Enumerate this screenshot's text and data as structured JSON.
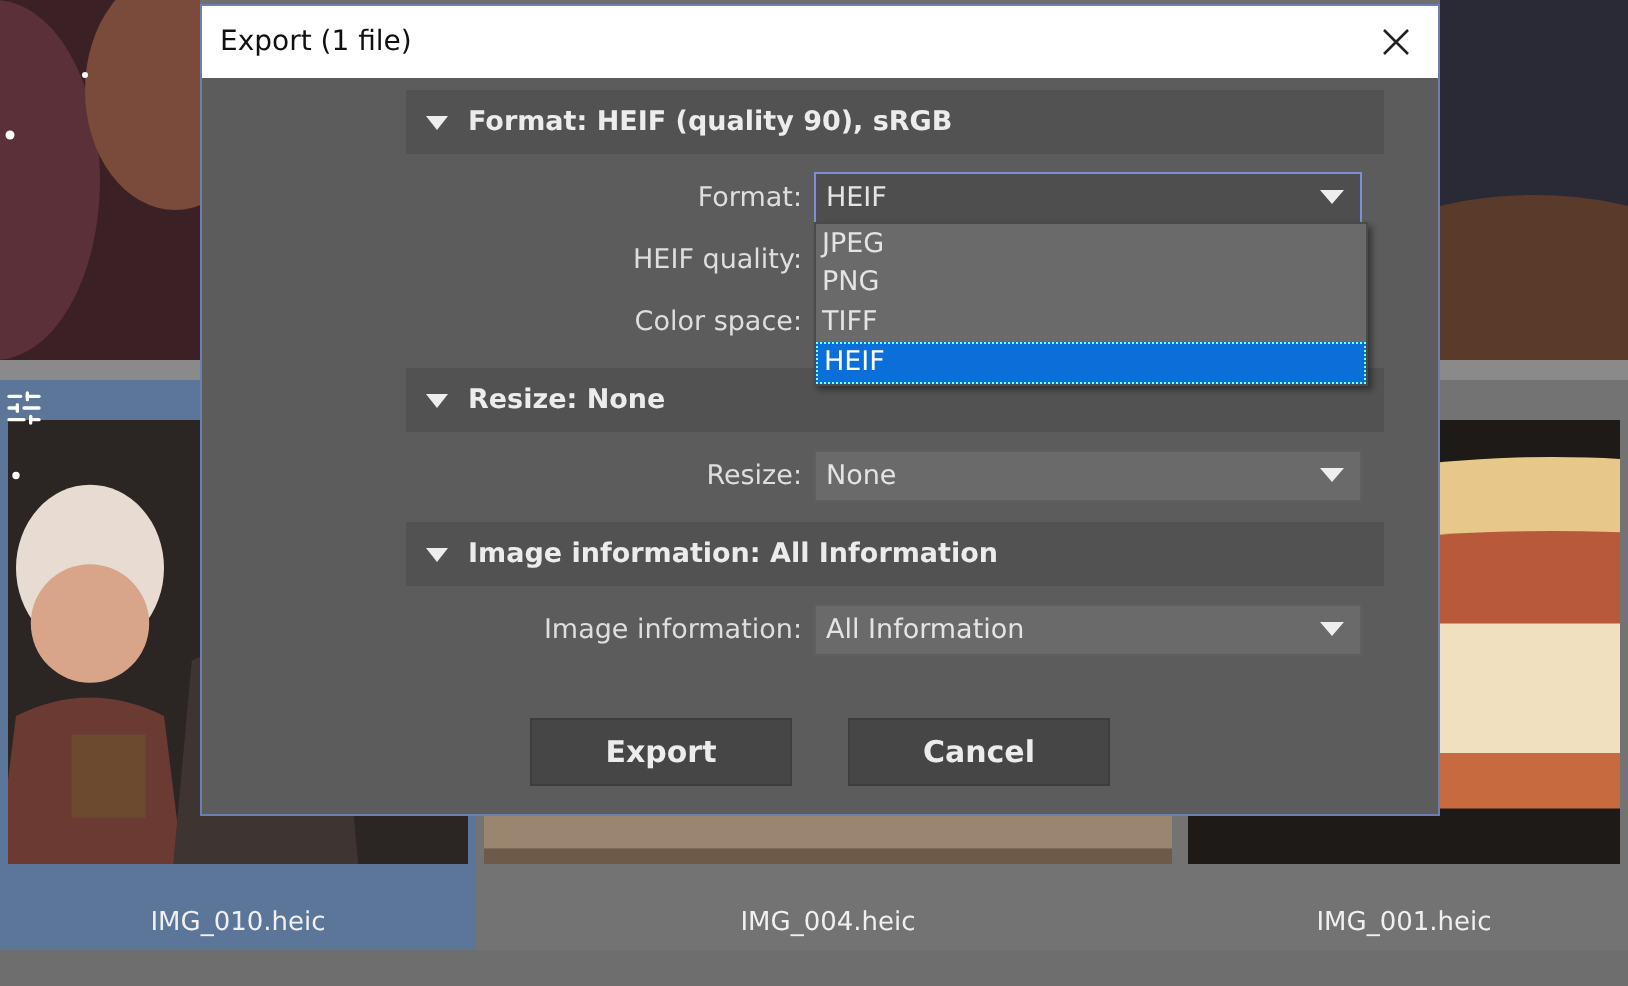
{
  "dialog": {
    "title": "Export (1 file)"
  },
  "sections": [
    {
      "title": "Format: HEIF (quality 90), sRGB",
      "expanded": true,
      "fields": [
        {
          "label": "Format:",
          "value": "HEIF",
          "open": true,
          "options": [
            {
              "label": "JPEG",
              "selected": false
            },
            {
              "label": "PNG",
              "selected": false
            },
            {
              "label": "TIFF",
              "selected": false
            },
            {
              "label": "HEIF",
              "selected": true
            }
          ]
        },
        {
          "label": "HEIF quality:"
        },
        {
          "label": "Color space:"
        }
      ]
    },
    {
      "title": "Resize: None",
      "expanded": true,
      "fields": [
        {
          "label": "Resize:",
          "value": "None",
          "open": false
        }
      ]
    },
    {
      "title": "Image information: All Information",
      "expanded": true,
      "fields": [
        {
          "label": "Image information:",
          "value": "All Information",
          "open": false
        }
      ]
    }
  ],
  "buttons": [
    "Export",
    "Cancel"
  ],
  "gallery": {
    "thumbnails": [
      {
        "name": "IMG_010.heic",
        "selected": true
      },
      {
        "name": "IMG_004.heic",
        "selected": false
      },
      {
        "name": "IMG_001.heic",
        "selected": false
      }
    ]
  }
}
